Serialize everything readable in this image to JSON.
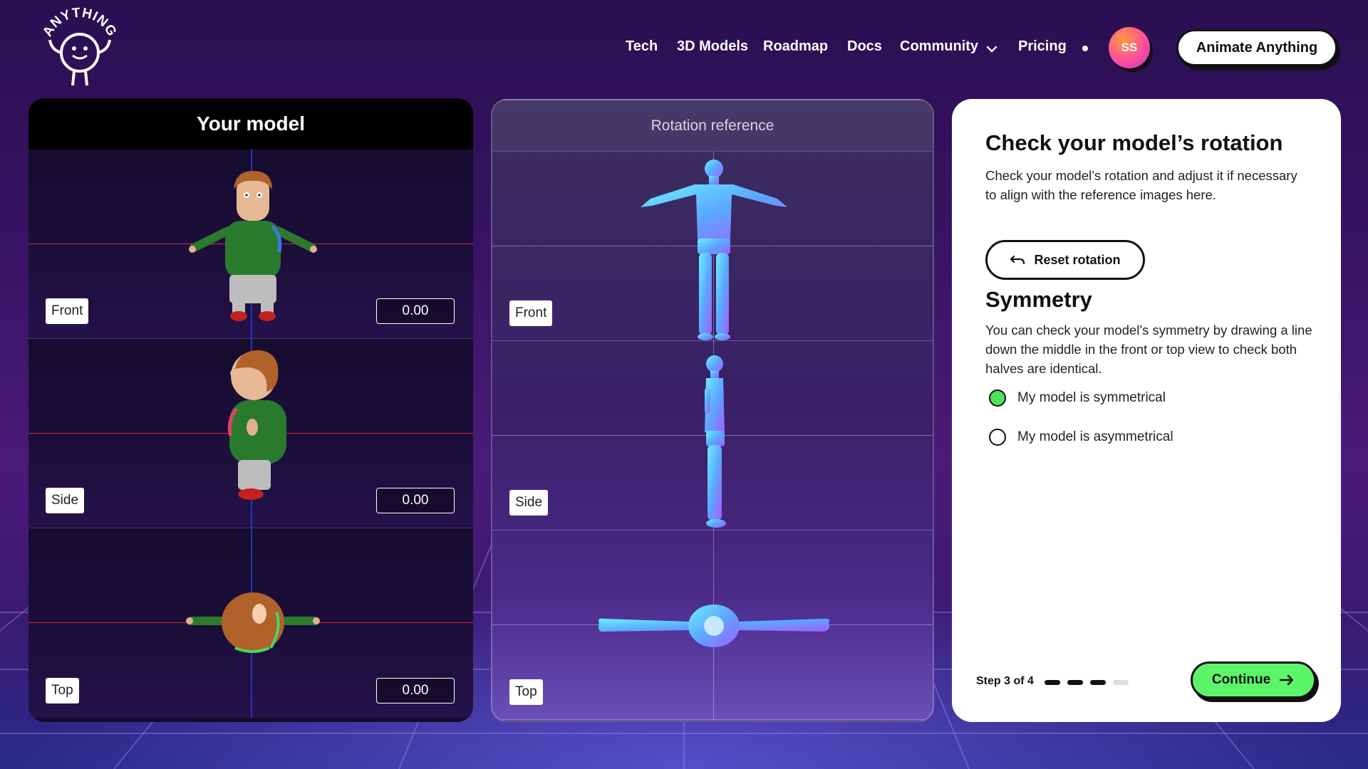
{
  "nav": {
    "logo_text": "ANYTHING",
    "links": [
      "Tech",
      "3D Models",
      "Roadmap",
      "Docs",
      "Community",
      "Pricing"
    ],
    "avatar_initials": "SS",
    "cta_label": "Animate Anything"
  },
  "model_panel": {
    "title": "Your model",
    "views": [
      {
        "label": "Front",
        "value": "0.00"
      },
      {
        "label": "Side",
        "value": "0.00"
      },
      {
        "label": "Top",
        "value": "0.00"
      }
    ]
  },
  "reference_panel": {
    "title": "Rotation reference",
    "views": [
      {
        "label": "Front"
      },
      {
        "label": "Side"
      },
      {
        "label": "Top"
      }
    ]
  },
  "info_panel": {
    "rotation_title": "Check your model’s rotation",
    "rotation_desc": "Check your model’s rotation and adjust it if necessary to align with the reference images here.",
    "reset_label": "Reset rotation",
    "symmetry_title": "Symmetry",
    "symmetry_desc": "You can check your model’s symmetry by drawing a line down the middle in the front or top view to check both halves are identical.",
    "options": [
      {
        "label": "My model is symmetrical",
        "selected": true
      },
      {
        "label": "My model is asymmetrical",
        "selected": false
      }
    ],
    "step_text": "Step 3 of 4",
    "step_current": 3,
    "step_total": 4,
    "continue_label": "Continue"
  },
  "colors": {
    "accent_green": "#5cf56a",
    "axis_red": "#d6253b",
    "axis_blue": "#2734b8"
  }
}
